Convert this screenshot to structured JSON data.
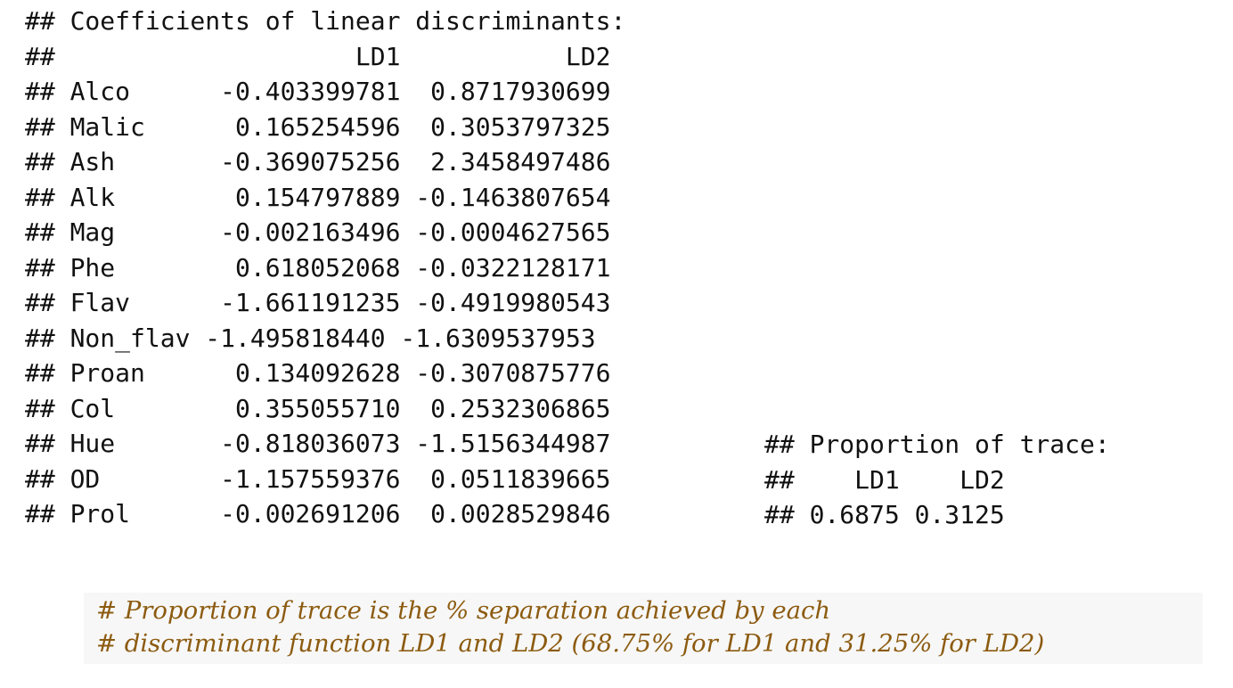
{
  "output": {
    "lines": [
      "## Coefficients of linear discriminants:",
      "##                    LD1           LD2",
      "## Alco      -0.403399781  0.8717930699",
      "## Malic      0.165254596  0.3053797325",
      "## Ash       -0.369075256  2.3458497486",
      "## Alk        0.154797889 -0.1463807654",
      "## Mag       -0.002163496 -0.0004627565",
      "## Phe        0.618052068 -0.0322128171",
      "## Flav      -1.661191235 -0.4919980543",
      "## Non_flav -1.495818440 -1.6309537953",
      "## Proan      0.134092628 -0.3070875776",
      "## Col        0.355055710  0.2532306865",
      "## Hue       -0.818036073 -1.5156344987",
      "## OD        -1.157559376  0.0511839665",
      "## Prol      -0.002691206  0.0028529846"
    ]
  },
  "trace": {
    "lines": [
      "## Proportion of trace:",
      "##    LD1    LD2",
      "## 0.6875 0.3125"
    ]
  },
  "comment": {
    "lines": [
      "# Proportion of trace is the % separation achieved by each",
      "# discriminant function LD1 and LD2 (68.75% for LD1 and 31.25% for LD2)"
    ]
  },
  "colors": {
    "output_text": "#111111",
    "comment_text": "#8c5b10",
    "comment_background": "#f7f7f7"
  }
}
